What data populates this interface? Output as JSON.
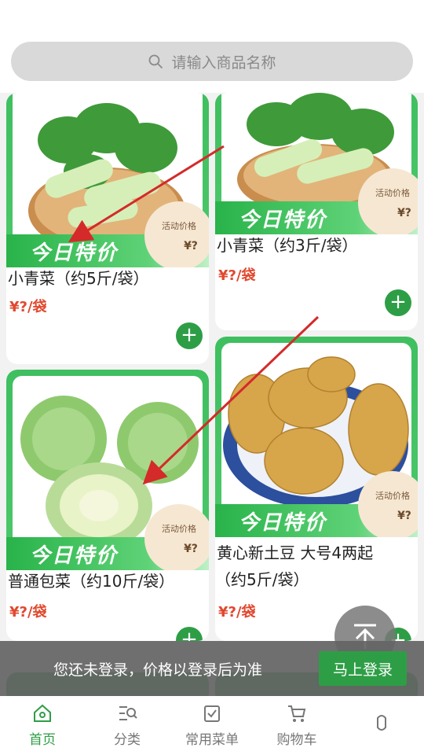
{
  "search": {
    "placeholder": "请输入商品名称"
  },
  "colors": {
    "brand": "#2e9e46",
    "price": "#e0492f"
  },
  "products": [
    {
      "name": "小青菜（约5斤/袋）",
      "price": "¥?/袋",
      "promo": "今日特价",
      "badge_label": "活动价格",
      "badge_price": "¥?"
    },
    {
      "name": "小青菜（约3斤/袋）",
      "price": "¥?/袋",
      "promo": "今日特价",
      "badge_label": "活动价格",
      "badge_price": "¥?"
    },
    {
      "name": "普通包菜（约10斤/袋）",
      "price": "¥?/袋",
      "promo": "今日特价",
      "badge_label": "活动价格",
      "badge_price": "¥?"
    },
    {
      "name_line1": "黄心新土豆 大号4两起",
      "name_line2": "（约5斤/袋）",
      "price": "¥?/袋",
      "promo": "今日特价",
      "badge_label": "活动价格",
      "badge_price": "¥?"
    }
  ],
  "login_bar": {
    "text": "您还未登录，价格以登录后为准",
    "button": "马上登录"
  },
  "tabbar": [
    {
      "label": "首页",
      "icon": "home-icon"
    },
    {
      "label": "分类",
      "icon": "category-icon"
    },
    {
      "label": "常用菜单",
      "icon": "menu-list-icon"
    },
    {
      "label": "购物车",
      "icon": "cart-icon"
    },
    {
      "label": "",
      "icon": "user-icon"
    }
  ]
}
